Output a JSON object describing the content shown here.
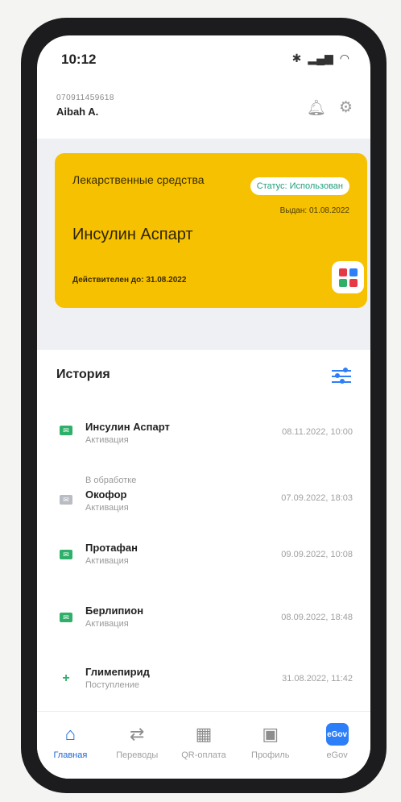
{
  "status": {
    "time": "10:12",
    "icons": [
      "bluetooth-icon",
      "signal-icon",
      "wifi-icon"
    ]
  },
  "user": {
    "id": "070911459618",
    "name": "Aibah A."
  },
  "card": {
    "type": "Лекарственные средства",
    "status": "Статус: Использован",
    "issued": "Выдан: 01.08.2022",
    "drug": "Инсулин Аспарт",
    "valid_until": "Действителен до: 31.08.2022",
    "background": "#f6c100"
  },
  "history": {
    "title": "История",
    "items": [
      {
        "note": "",
        "name": "Инсулин Аспарт",
        "sub": "Активация",
        "date": "08.11.2022, 10:00",
        "color": "#2fb06a"
      },
      {
        "note": "В обработке",
        "name": "Окофор",
        "sub": "Активация",
        "date": "07.09.2022, 18:03",
        "color": "#b9bcc2"
      },
      {
        "note": "",
        "name": "Протафан",
        "sub": "Активация",
        "date": "09.09.2022, 10:08",
        "color": "#2fb06a"
      },
      {
        "note": "",
        "name": "Берлипион",
        "sub": "Активация",
        "date": "08.09.2022, 18:48",
        "color": "#2fb06a"
      },
      {
        "note": "",
        "name": "Глимепирид",
        "sub": "Поступление",
        "date": "31.08.2022, 11:42",
        "color": "#2fb06a"
      }
    ]
  },
  "nav": {
    "items": [
      {
        "label": "Главная",
        "icon": "home-icon"
      },
      {
        "label": "Переводы",
        "icon": "transfer-icon"
      },
      {
        "label": "QR-оплата",
        "icon": "qr-icon"
      },
      {
        "label": "Профиль",
        "icon": "profile-icon"
      },
      {
        "label": "eGov",
        "icon": "egov-icon",
        "badge": "eGov"
      }
    ]
  },
  "colors": {
    "accent": "#2d7ff9",
    "card": "#f6c100",
    "status_text": "#1f9e7b"
  }
}
